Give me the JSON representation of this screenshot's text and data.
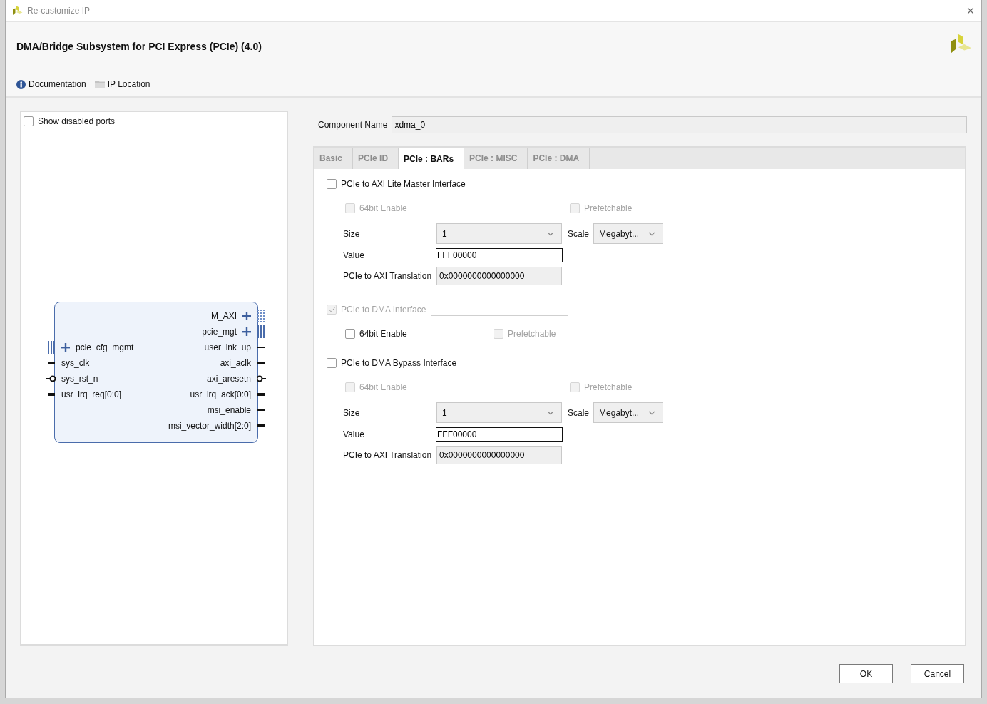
{
  "window": {
    "title": "Re-customize IP"
  },
  "header": {
    "title": "DMA/Bridge Subsystem for PCI Express (PCIe) (4.0)",
    "links": [
      {
        "label": "Documentation",
        "kind": "info"
      },
      {
        "label": "IP Location",
        "kind": "folder"
      }
    ]
  },
  "left_panel": {
    "show_disabled_ports": {
      "label": "Show disabled ports",
      "checked": false
    },
    "block": {
      "left_ports": [
        {
          "name": "pcie_cfg_mgmt",
          "kind": "interface"
        },
        {
          "name": "sys_clk",
          "kind": "wire"
        },
        {
          "name": "sys_rst_n",
          "kind": "reset"
        },
        {
          "name": "usr_irq_req[0:0]",
          "kind": "bus"
        }
      ],
      "right_ports": [
        {
          "name": "M_AXI",
          "kind": "interface_dotted"
        },
        {
          "name": "pcie_mgt",
          "kind": "interface"
        },
        {
          "name": "user_lnk_up",
          "kind": "wire"
        },
        {
          "name": "axi_aclk",
          "kind": "wire"
        },
        {
          "name": "axi_aresetn",
          "kind": "reset"
        },
        {
          "name": "usr_irq_ack[0:0]",
          "kind": "bus"
        },
        {
          "name": "msi_enable",
          "kind": "wire"
        },
        {
          "name": "msi_vector_width[2:0]",
          "kind": "bus"
        }
      ]
    }
  },
  "component_name": {
    "label": "Component Name",
    "value": "xdma_0"
  },
  "tabs": [
    {
      "label": "Basic",
      "selected": false
    },
    {
      "label": "PCIe ID",
      "selected": false
    },
    {
      "label": "PCIe : BARs",
      "selected": true
    },
    {
      "label": "PCIe : MISC",
      "selected": false
    },
    {
      "label": "PCIe : DMA",
      "selected": false
    }
  ],
  "sections": [
    {
      "kind": "with_bar_settings",
      "label": "PCIe to AXI Lite Master Interface",
      "checked": false,
      "disabled": false,
      "options": [
        {
          "label": "64bit Enable",
          "checked": false,
          "disabled": true
        },
        {
          "label": "Prefetchable",
          "checked": false,
          "disabled": true
        }
      ],
      "size_label": "Size",
      "size": "1",
      "scale_label": "Scale",
      "scale": "Megabyt...",
      "value_label": "Value",
      "value": "FFF00000",
      "translation_label": "PCIe to AXI Translation",
      "translation": "0x0000000000000000"
    },
    {
      "kind": "flags_only",
      "label": "PCIe to DMA Interface",
      "checked": true,
      "disabled": true,
      "options": [
        {
          "label": "64bit Enable",
          "checked": false,
          "disabled": false
        },
        {
          "label": "Prefetchable",
          "checked": false,
          "disabled": true
        }
      ]
    },
    {
      "kind": "with_bar_settings",
      "label": "PCIe to DMA Bypass Interface",
      "checked": false,
      "disabled": false,
      "options": [
        {
          "label": "64bit Enable",
          "checked": false,
          "disabled": true
        },
        {
          "label": "Prefetchable",
          "checked": false,
          "disabled": true
        }
      ],
      "size_label": "Size",
      "size": "1",
      "scale_label": "Scale",
      "scale": "Megabyt...",
      "value_label": "Value",
      "value": "FFF00000",
      "translation_label": "PCIe to AXI Translation",
      "translation": "0x0000000000000000"
    }
  ],
  "buttons": [
    {
      "label": "OK"
    },
    {
      "label": "Cancel"
    }
  ]
}
